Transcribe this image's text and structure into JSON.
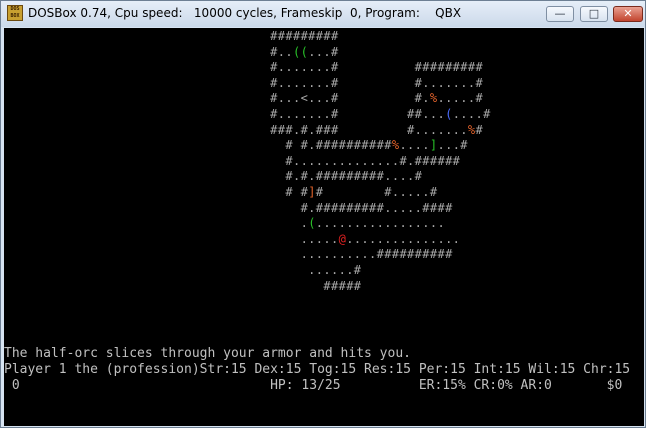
{
  "window": {
    "title": "DOSBox 0.74, Cpu speed:   10000 cycles, Frameskip  0, Program:    QBX",
    "icon_label": "DOS BOX",
    "buttons": {
      "minimize": "—",
      "maximize": "□",
      "close": "✕"
    }
  },
  "map": {
    "rows": [
      {
        "segments": [
          {
            "t": "                                   #########"
          }
        ]
      },
      {
        "segments": [
          {
            "t": "                                   #.."
          },
          {
            "t": "((",
            "c": "g"
          },
          {
            "t": "...#"
          }
        ]
      },
      {
        "segments": [
          {
            "t": "                                   #.......#          #########"
          }
        ]
      },
      {
        "segments": [
          {
            "t": "                                   #.......#          #.......#"
          }
        ]
      },
      {
        "segments": [
          {
            "t": "                                   #...<...#          #."
          },
          {
            "t": "%",
            "c": "o"
          },
          {
            "t": ".....#"
          }
        ]
      },
      {
        "segments": [
          {
            "t": "                                   #.......#         ##..."
          },
          {
            "t": "(",
            "c": "b"
          },
          {
            "t": "....#"
          }
        ]
      },
      {
        "segments": [
          {
            "t": "                                   ###.#.###         #.......",
            "c": ""
          },
          {
            "t": "%",
            "c": "o"
          },
          {
            "t": "#"
          }
        ]
      },
      {
        "segments": [
          {
            "t": "                                     # #.##########"
          },
          {
            "t": "%",
            "c": "o"
          },
          {
            "t": "...."
          },
          {
            "t": "]",
            "c": "g"
          },
          {
            "t": "...#"
          }
        ]
      },
      {
        "segments": [
          {
            "t": "                                     #..............#.######"
          }
        ]
      },
      {
        "segments": [
          {
            "t": "                                     #.#.#########....#"
          }
        ]
      },
      {
        "segments": [
          {
            "t": "                                     # #"
          },
          {
            "t": "]",
            "c": "o"
          },
          {
            "t": "#        #.....#"
          }
        ]
      },
      {
        "segments": [
          {
            "t": "                                       #.#########.....####"
          }
        ]
      },
      {
        "segments": [
          {
            "t": "                                       ."
          },
          {
            "t": "(",
            "c": "g"
          },
          {
            "t": "................."
          }
        ]
      },
      {
        "segments": [
          {
            "t": "                                       ....."
          },
          {
            "t": "@",
            "c": "r"
          },
          {
            "t": "..............."
          }
        ]
      },
      {
        "segments": [
          {
            "t": "                                       ..........##########"
          }
        ]
      },
      {
        "segments": [
          {
            "t": "                                        ......#"
          }
        ]
      },
      {
        "segments": [
          {
            "t": "                                          #####"
          }
        ]
      }
    ]
  },
  "messages": {
    "combat": "The half-orc slices through your armor and hits you.",
    "status_line1": "Player 1 the (profession)Str:15 Dex:15 Tog:15 Res:15 Per:15 Int:15 Wil:15 Chr:15",
    "status_line2": " 0                                HP: 13/25          ER:15% CR:0% AR:0       $0"
  }
}
